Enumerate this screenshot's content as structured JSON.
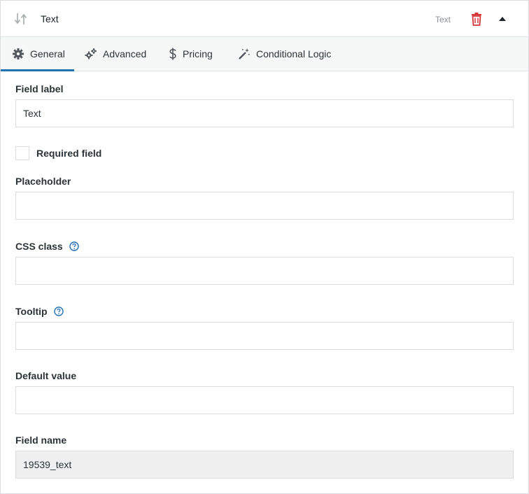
{
  "header": {
    "title": "Text",
    "type_label": "Text",
    "sort_icon": "sort-arrows-icon",
    "delete_icon": "trash-icon",
    "toggle_icon": "caret-up-icon"
  },
  "tabs": [
    {
      "label": "General",
      "icon": "gear-icon",
      "active": true
    },
    {
      "label": "Advanced",
      "icon": "gears-icon",
      "active": false
    },
    {
      "label": "Pricing",
      "icon": "dollar-icon",
      "active": false
    },
    {
      "label": "Conditional Logic",
      "icon": "magic-wand-icon",
      "active": false
    }
  ],
  "form": {
    "field_label": {
      "label": "Field label",
      "value": "Text"
    },
    "required": {
      "label": "Required field",
      "checked": false
    },
    "placeholder": {
      "label": "Placeholder",
      "value": ""
    },
    "css_class": {
      "label": "CSS class",
      "value": ""
    },
    "tooltip": {
      "label": "Tooltip",
      "value": ""
    },
    "default_value": {
      "label": "Default value",
      "value": ""
    },
    "field_name": {
      "label": "Field name",
      "value": "19539_text"
    }
  },
  "colors": {
    "accent": "#2271b1",
    "delete": "#d63638",
    "border": "#dcdcde",
    "tabs_bg": "#f6f7f7",
    "readonly_bg": "#f0f0f1"
  }
}
